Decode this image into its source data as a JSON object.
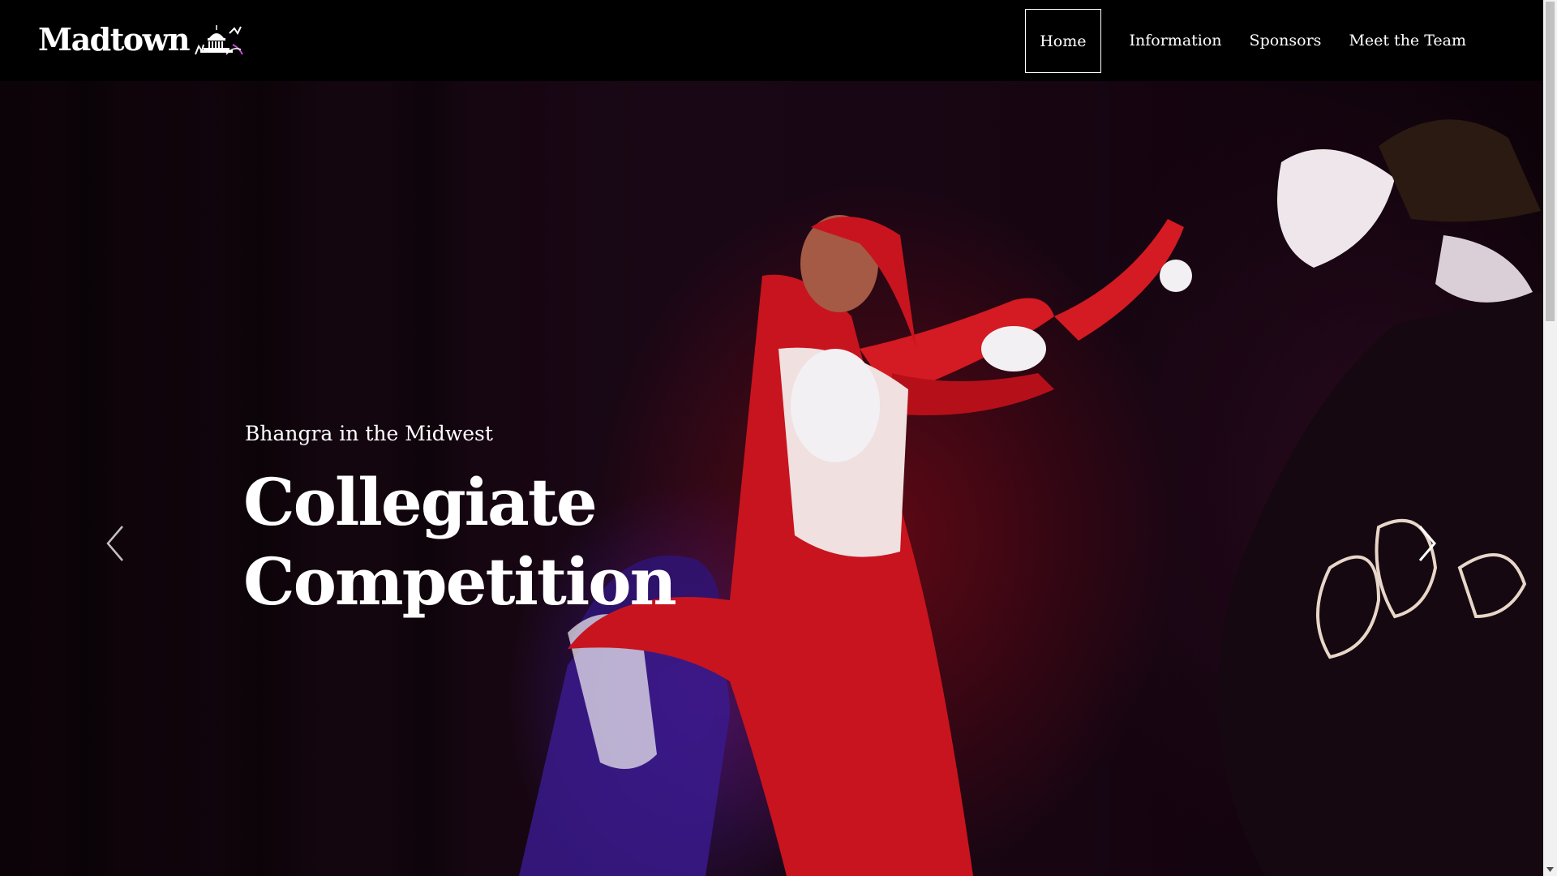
{
  "brand": {
    "name": "Madtown",
    "logo_icon": "capitol-dome-dancer-icon"
  },
  "nav": {
    "items": [
      {
        "label": "Home",
        "active": true
      },
      {
        "label": "Information",
        "active": false
      },
      {
        "label": "Sponsors",
        "active": false
      },
      {
        "label": "Meet the Team",
        "active": false
      }
    ]
  },
  "hero": {
    "subtitle": "Bhangra in the Midwest",
    "title_line1": "Collegiate",
    "title_line2": "Competition",
    "prev_icon": "chevron-left-icon",
    "next_icon": "chevron-right-icon"
  },
  "colors": {
    "header_bg": "#000000",
    "text": "#ffffff",
    "accent_red": "#c8141e",
    "accent_purple": "#4a1e96"
  }
}
